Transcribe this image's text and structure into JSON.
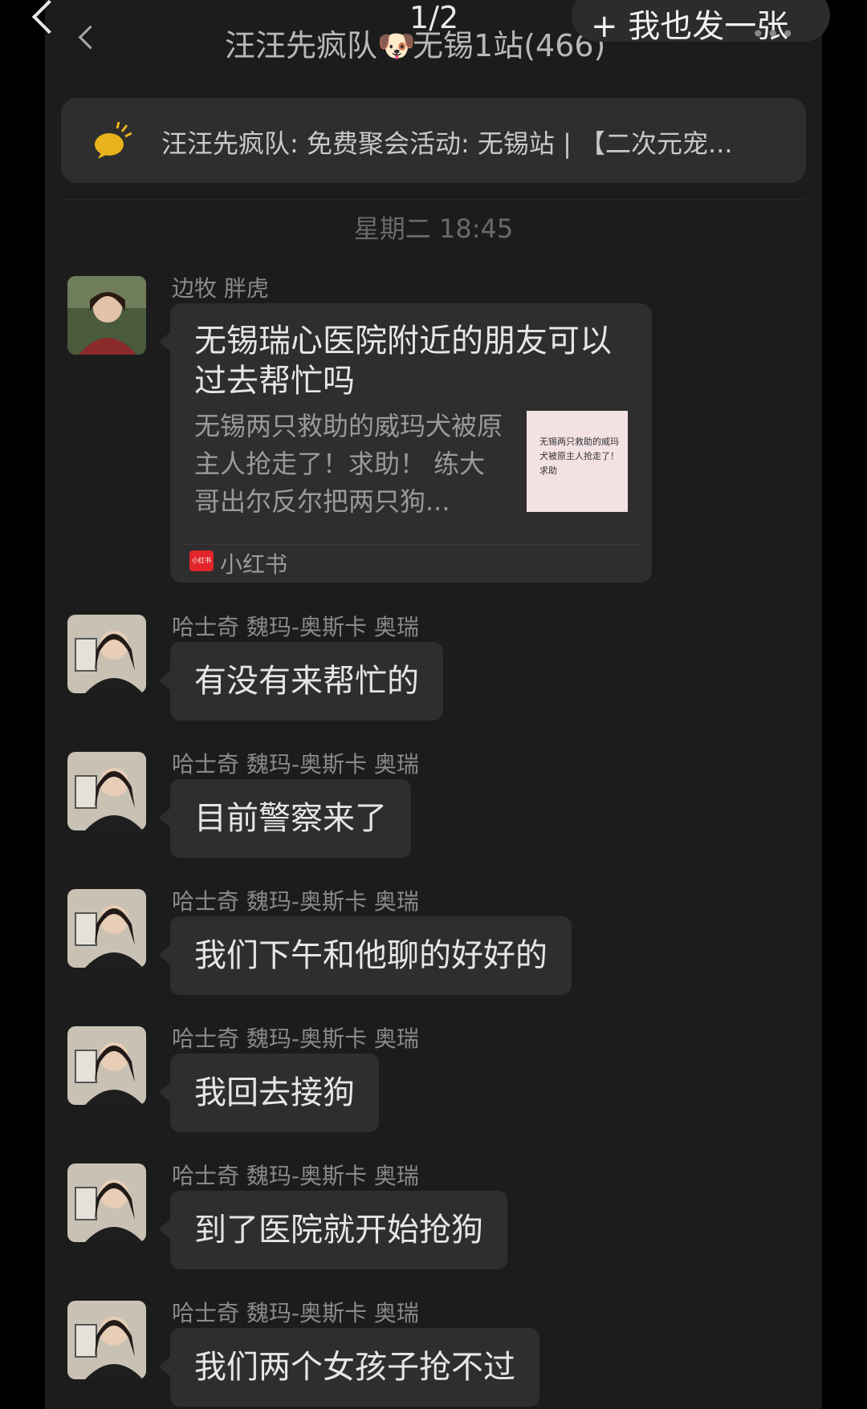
{
  "header": {
    "page_counter": "1/2",
    "chat_title_prefix": "汪汪先疯队",
    "chat_title_emoji": "🐶",
    "chat_title_suffix": "无锡1站(466)",
    "share_label": "+ 我也发一张",
    "more_icon": "more-icon"
  },
  "notice": {
    "text": "汪汪先疯队: 免费聚会活动:   无锡站 | 【二次元宠..."
  },
  "timestamp": "星期二 18:45",
  "colors": {
    "background": "#1c1c1c",
    "bubble": "#2e2e2e",
    "accent_yellow": "#e8b21c",
    "brand_red": "#e0262b"
  },
  "messages": [
    {
      "sender": "边牧 胖虎",
      "type": "link",
      "title": "无锡瑞心医院附近的朋友可以过去帮忙吗",
      "description": "无锡两只救助的威玛犬被原主人抢走了！求助！ 练大哥出尔反尔把两只狗...",
      "thumb_text": "无锡两只救助的威玛犬被原主人抢走了！求助",
      "source": "小红书",
      "source_icon_text": "小红书"
    },
    {
      "sender": "哈士奇 魏玛-奥斯卡 奥瑞",
      "text": "有没有来帮忙的"
    },
    {
      "sender": "哈士奇 魏玛-奥斯卡 奥瑞",
      "text": "目前警察来了"
    },
    {
      "sender": "哈士奇 魏玛-奥斯卡 奥瑞",
      "text": "我们下午和他聊的好好的"
    },
    {
      "sender": "哈士奇 魏玛-奥斯卡 奥瑞",
      "text": "我回去接狗"
    },
    {
      "sender": "哈士奇 魏玛-奥斯卡 奥瑞",
      "text": "到了医院就开始抢狗"
    },
    {
      "sender": "哈士奇 魏玛-奥斯卡 奥瑞",
      "text": "我们两个女孩子抢不过"
    }
  ]
}
